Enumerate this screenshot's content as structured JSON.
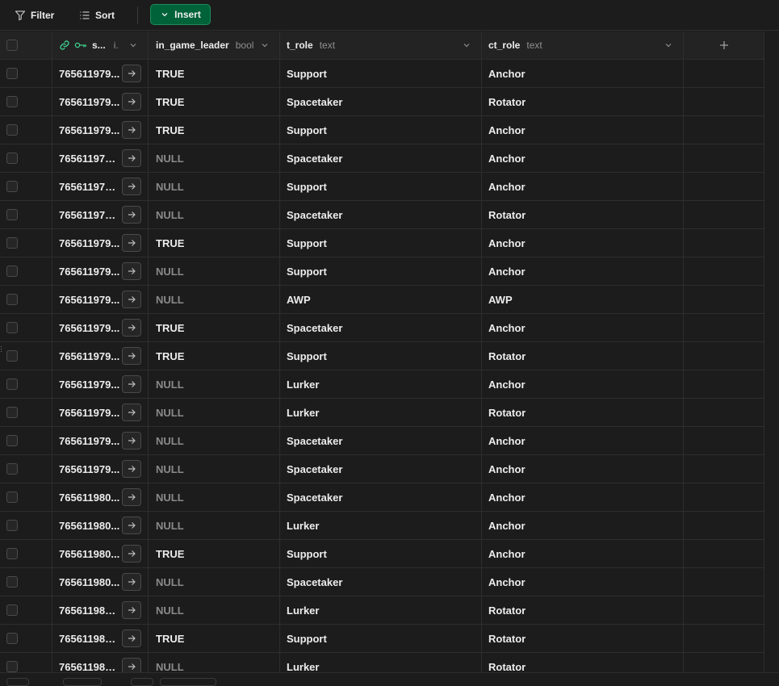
{
  "toolbar": {
    "filter_label": "Filter",
    "sort_label": "Sort",
    "insert_label": "Insert"
  },
  "columns": {
    "id": {
      "name": "s...",
      "type": "i."
    },
    "igl": {
      "name": "in_game_leader",
      "type": "bool"
    },
    "t_role": {
      "name": "t_role",
      "type": "text"
    },
    "ct_role": {
      "name": "ct_role",
      "type": "text"
    }
  },
  "rows": [
    {
      "id": "765611979...",
      "igl": "TRUE",
      "t_role": "Support",
      "ct_role": "Anchor"
    },
    {
      "id": "765611979...",
      "igl": "TRUE",
      "t_role": "Spacetaker",
      "ct_role": "Rotator"
    },
    {
      "id": "765611979...",
      "igl": "TRUE",
      "t_role": "Support",
      "ct_role": "Anchor"
    },
    {
      "id": "7656119797...",
      "igl": "NULL",
      "t_role": "Spacetaker",
      "ct_role": "Anchor"
    },
    {
      "id": "7656119797...",
      "igl": "NULL",
      "t_role": "Support",
      "ct_role": "Anchor"
    },
    {
      "id": "7656119797...",
      "igl": "NULL",
      "t_role": "Spacetaker",
      "ct_role": "Rotator"
    },
    {
      "id": "765611979...",
      "igl": "TRUE",
      "t_role": "Support",
      "ct_role": "Anchor"
    },
    {
      "id": "765611979...",
      "igl": "NULL",
      "t_role": "Support",
      "ct_role": "Anchor"
    },
    {
      "id": "765611979...",
      "igl": "NULL",
      "t_role": "AWP",
      "ct_role": "AWP"
    },
    {
      "id": "765611979...",
      "igl": "TRUE",
      "t_role": "Spacetaker",
      "ct_role": "Anchor"
    },
    {
      "id": "765611979...",
      "igl": "TRUE",
      "t_role": "Support",
      "ct_role": "Rotator"
    },
    {
      "id": "765611979...",
      "igl": "NULL",
      "t_role": "Lurker",
      "ct_role": "Anchor"
    },
    {
      "id": "765611979...",
      "igl": "NULL",
      "t_role": "Lurker",
      "ct_role": "Rotator"
    },
    {
      "id": "765611979...",
      "igl": "NULL",
      "t_role": "Spacetaker",
      "ct_role": "Anchor"
    },
    {
      "id": "765611979...",
      "igl": "NULL",
      "t_role": "Spacetaker",
      "ct_role": "Anchor"
    },
    {
      "id": "765611980...",
      "igl": "NULL",
      "t_role": "Spacetaker",
      "ct_role": "Anchor"
    },
    {
      "id": "765611980...",
      "igl": "NULL",
      "t_role": "Lurker",
      "ct_role": "Anchor"
    },
    {
      "id": "765611980...",
      "igl": "TRUE",
      "t_role": "Support",
      "ct_role": "Anchor"
    },
    {
      "id": "765611980...",
      "igl": "NULL",
      "t_role": "Spacetaker",
      "ct_role": "Anchor"
    },
    {
      "id": "7656119801...",
      "igl": "NULL",
      "t_role": "Lurker",
      "ct_role": "Rotator"
    },
    {
      "id": "7656119801...",
      "igl": "TRUE",
      "t_role": "Support",
      "ct_role": "Rotator"
    },
    {
      "id": "7656119801...",
      "igl": "NULL",
      "t_role": "Lurker",
      "ct_role": "Rotator"
    }
  ],
  "colors": {
    "accent": "#3ecf8e",
    "insert_bg": "#006239",
    "null_text": "#8a8a8a"
  }
}
